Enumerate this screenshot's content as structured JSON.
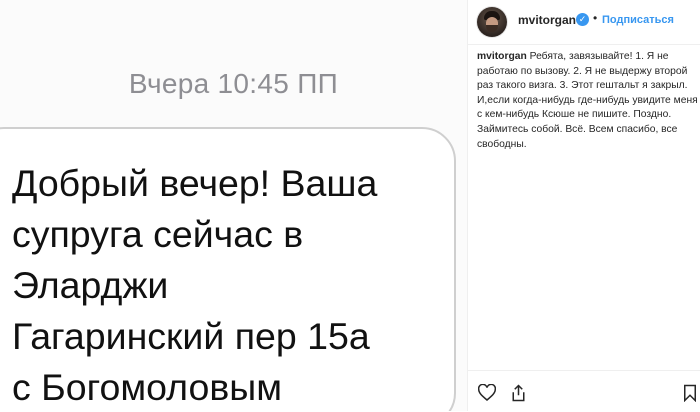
{
  "media": {
    "timestamp": "Вчера 10:45 ПП",
    "message_lines": [
      "Добрый вечер! Ваша",
      "супруга сейчас в",
      "Эларджи",
      "Гагаринский пер 15а",
      "с Богомоловым"
    ]
  },
  "post": {
    "username": "mvitorgan",
    "separator": "•",
    "follow_label": "Подписаться",
    "caption_username": "mvitorgan",
    "caption_text": "Ребята, завязывайте! 1. Я не работаю по вызову. 2. Я не выдержу второй раз такого визга. 3. Этот гештальт я закрыл. И,если когда-нибудь где-нибудь увидите меня с кем-нибудь Ксюше не пишите. Поздно. Займитесь собой. Всё. Всем спасибо, все свободны."
  },
  "actions": {
    "icons": [
      "heart-icon",
      "share-icon",
      "bookmark-icon"
    ]
  },
  "colors": {
    "accent": "#3897f0",
    "text": "#262626",
    "muted": "#8e8e93"
  }
}
